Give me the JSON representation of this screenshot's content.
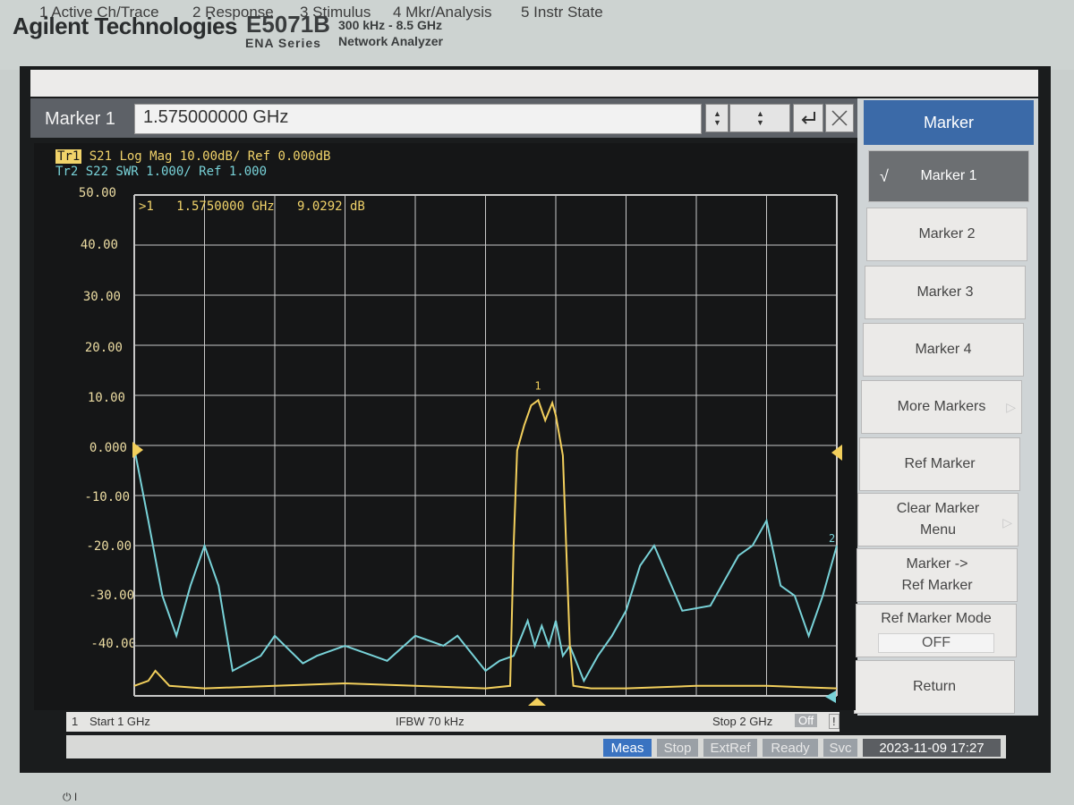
{
  "brand": "Agilent Technologies",
  "model": "E5071B",
  "series": "ENA  Series",
  "freq_range": "300 kHz - 8.5 GHz",
  "analyzer": "Network Analyzer",
  "menu": [
    "1 Active Ch/Trace",
    "2 Response",
    "3 Stimulus",
    "4 Mkr/Analysis",
    "5 Instr State"
  ],
  "entry": {
    "label": "Marker 1",
    "value": "1.575000000 GHz",
    "up_down_1": "▲▼",
    "up_down_2": "▲▼",
    "enter_icon": "enter-icon",
    "close_icon": "close-icon"
  },
  "softkeys": {
    "title": "Marker",
    "items": [
      {
        "label": "Marker 1",
        "active": true
      },
      {
        "label": "Marker 2"
      },
      {
        "label": "Marker 3"
      },
      {
        "label": "Marker 4"
      },
      {
        "label": "More Markers",
        "submenu": true
      },
      {
        "label": "Ref Marker"
      },
      {
        "label": "Clear Marker",
        "label2": "Menu",
        "submenu": true
      },
      {
        "label": "Marker ->",
        "label2": "Ref Marker"
      },
      {
        "label": "Ref Marker Mode",
        "value": "OFF"
      },
      {
        "label": "Return"
      }
    ]
  },
  "traces": {
    "tr1_tag": "Tr1",
    "tr1_desc": "S21 Log Mag 10.00dB/ Ref 0.000dB",
    "tr2_desc": "Tr2 S22 SWR 1.000/ Ref 1.000"
  },
  "marker_readout": ">1   1.5750000 GHz   9.0292 dB",
  "marker_label": "1",
  "trace2_end_label": "2",
  "status": {
    "channel": "1",
    "start": "Start 1 GHz",
    "ifbw": "IFBW 70 kHz",
    "stop": "Stop 2 GHz",
    "off": "Off",
    "warn": "!"
  },
  "bottom": {
    "meas": "Meas",
    "stop": "Stop",
    "extref": "ExtRef",
    "ready": "Ready",
    "svc": "Svc",
    "datetime": "2023-11-09 17:27"
  },
  "colors": {
    "trace1": "#f2cf5c",
    "trace2": "#78d2d8",
    "grid": "#c8c8c8",
    "meas_accent": "#3a73c1"
  },
  "chart_data": {
    "type": "line",
    "x_unit": "GHz",
    "xlim": [
      1.0,
      2.0
    ],
    "ylim": [
      -50,
      50
    ],
    "ref_value": 0.0,
    "yticks": [
      "50.00",
      "40.00",
      "30.00",
      "20.00",
      "10.00",
      "0.000",
      "-10.00",
      "-20.00",
      "-30.00",
      "-40.00"
    ],
    "series": [
      {
        "name": "Tr1",
        "x": [
          1.0,
          1.02,
          1.03,
          1.05,
          1.1,
          1.2,
          1.3,
          1.4,
          1.5,
          1.535,
          1.54,
          1.545,
          1.555,
          1.565,
          1.575,
          1.585,
          1.595,
          1.6,
          1.61,
          1.62,
          1.625,
          1.65,
          1.7,
          1.8,
          1.9,
          2.0
        ],
        "y": [
          -48,
          -47,
          -45,
          -48,
          -48.5,
          -48,
          -47.5,
          -48,
          -48.5,
          -48,
          -20,
          -1,
          4,
          8,
          9.03,
          5,
          8.5,
          6,
          -2,
          -40,
          -48,
          -48.5,
          -48.5,
          -48,
          -48,
          -48.5
        ]
      },
      {
        "name": "Tr2",
        "x": [
          1.0,
          1.02,
          1.04,
          1.06,
          1.08,
          1.1,
          1.12,
          1.14,
          1.18,
          1.2,
          1.24,
          1.26,
          1.3,
          1.34,
          1.36,
          1.4,
          1.44,
          1.46,
          1.5,
          1.52,
          1.54,
          1.56,
          1.57,
          1.58,
          1.59,
          1.6,
          1.61,
          1.62,
          1.64,
          1.66,
          1.68,
          1.7,
          1.72,
          1.74,
          1.78,
          1.82,
          1.86,
          1.88,
          1.9,
          1.92,
          1.94,
          1.96,
          1.98,
          2.0
        ],
        "y": [
          -0.5,
          -15,
          -30,
          -38,
          -28,
          -20,
          -28,
          -45,
          -42,
          -38,
          -43.5,
          -42,
          -40,
          -42,
          -43,
          -38,
          -40,
          -38,
          -45,
          -43,
          -42,
          -35,
          -40,
          -36,
          -40,
          -35,
          -42,
          -40,
          -47,
          -42,
          -38,
          -33,
          -24,
          -20,
          -33,
          -32,
          -22,
          -20,
          -15,
          -28,
          -30,
          -38,
          -30,
          -20
        ]
      }
    ]
  }
}
